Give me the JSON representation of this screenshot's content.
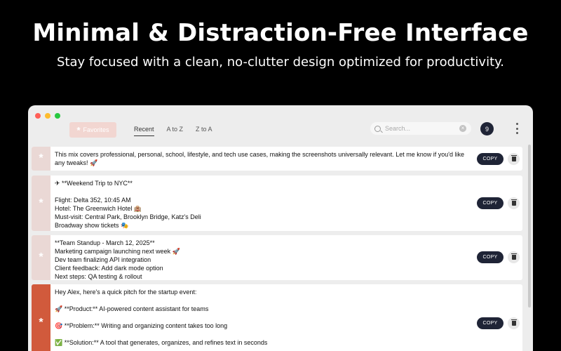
{
  "hero": {
    "title": "Minimal & Distraction-Free Interface",
    "subtitle": "Stay focused with a clean, no-clutter design optimized for productivity."
  },
  "toolbar": {
    "favorites_label": "Favorites",
    "favorites_icon": "asterisk-icon",
    "tabs": [
      "Recent",
      "A to Z",
      "Z to A"
    ],
    "active_tab": "Recent",
    "search_placeholder": "Search...",
    "count": "9"
  },
  "colors": {
    "accent": "#d15a3c",
    "strip": "#ead8d5",
    "dark_button": "#1f2436"
  },
  "cards": [
    {
      "lines": [
        "This mix covers professional, personal, school, lifestyle, and tech use cases, making the screenshots universally relevant. Let me know if you'd like",
        "any tweaks! 🚀"
      ],
      "copy_label": "COPY",
      "accent": false
    },
    {
      "lines": [
        "✈ **Weekend Trip to NYC**",
        "",
        "Flight: Delta 352, 10:45 AM",
        "Hotel: The Greenwich Hotel 🏨",
        "Must-visit: Central Park, Brooklyn Bridge, Katz's Deli",
        "Broadway show tickets 🎭"
      ],
      "copy_label": "COPY",
      "accent": false
    },
    {
      "lines": [
        "**Team Standup - March 12, 2025**",
        "Marketing campaign launching next week 🚀",
        "Dev team finalizing API integration",
        "Client feedback: Add dark mode option",
        "Next steps: QA testing & rollout"
      ],
      "copy_label": "COPY",
      "accent": false
    },
    {
      "lines": [
        "Hey Alex, here's a quick pitch for the startup event:",
        "",
        "🚀 **Product:** AI-powered content assistant for teams",
        "",
        "🎯 **Problem:** Writing and organizing content takes too long",
        "",
        "✅ **Solution:** A tool that generates, organizes, and refines text in seconds"
      ],
      "copy_label": "COPY",
      "accent": true
    }
  ]
}
